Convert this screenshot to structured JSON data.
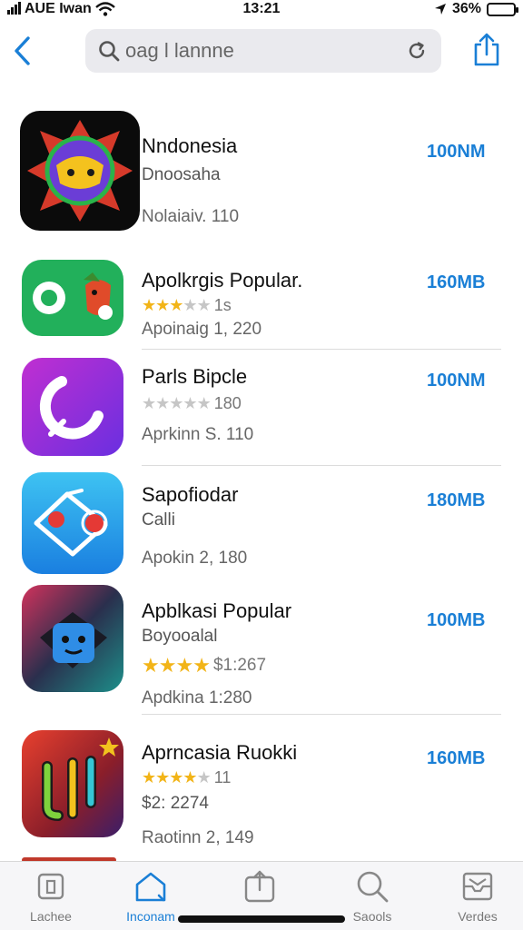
{
  "status_bar": {
    "carrier": "AUE Iwan",
    "time": "13:21",
    "battery": "36%"
  },
  "nav": {
    "search_placeholder": "oag l lannne",
    "search_value": ""
  },
  "apps": [
    {
      "name": "Nndonesia",
      "subtitle": "Dnoosaha",
      "meta": "Nolaiaiv. 110",
      "size": "100NM",
      "stars_on": 0,
      "stars_off": 0,
      "rating_text": ""
    },
    {
      "name": "Apolkrgis Popular.",
      "subtitle": "",
      "meta": "Apoinaig 1, 220",
      "size": "160MB",
      "stars_on": 3,
      "stars_off": 2,
      "rating_text": "1s"
    },
    {
      "name": "Parls Bipcle",
      "subtitle": "",
      "meta": "Aprkinn S. 110",
      "size": "100NM",
      "stars_on": 0,
      "stars_off": 5,
      "rating_text": "180"
    },
    {
      "name": "Sapofiodar",
      "subtitle": "Calli",
      "meta": "Apokin 2, 180",
      "size": "180MB",
      "stars_on": 0,
      "stars_off": 0,
      "rating_text": ""
    },
    {
      "name": "Apblkasi Popular",
      "subtitle": "Boyooalal",
      "meta": "Apdkina 1:280",
      "size": "100MB",
      "stars_on": 4,
      "stars_off": 0,
      "rating_text": "$1:267"
    },
    {
      "name": "Aprncasia Ruokki",
      "subtitle": "$2: 2274",
      "meta": "Raotinn 2, 149",
      "size": "160MB",
      "stars_on": 4,
      "stars_off": 1,
      "rating_text": "11"
    }
  ],
  "tabs": [
    {
      "label": "Lachee",
      "icon": "square-icon",
      "active": false
    },
    {
      "label": "Inconam",
      "icon": "house-icon",
      "active": true
    },
    {
      "label": "",
      "icon": "share-box-icon",
      "active": false
    },
    {
      "label": "Saools",
      "icon": "search-icon",
      "active": false
    },
    {
      "label": "Verdes",
      "icon": "inbox-icon",
      "active": false
    }
  ],
  "colors": {
    "accent": "#1a7fd6",
    "star": "#f2b418",
    "star_off": "#c6c6c6"
  }
}
